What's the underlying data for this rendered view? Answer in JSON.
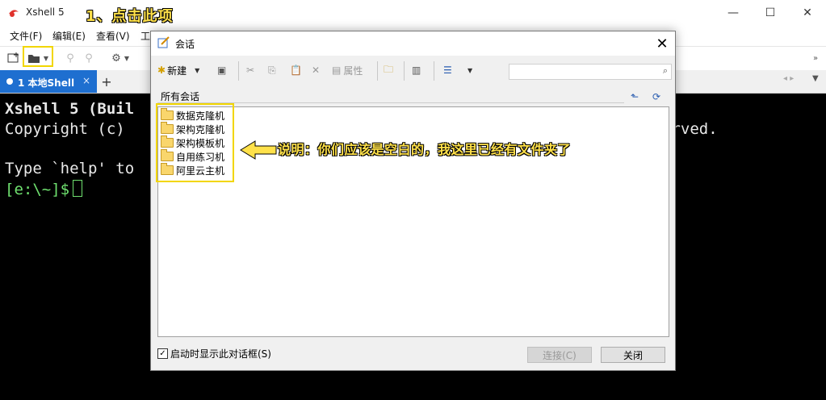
{
  "app": {
    "title": "Xshell 5",
    "brand_color": "#e0322d"
  },
  "annotation_top": "1、点击此项",
  "menu": [
    "文件(F)",
    "编辑(E)",
    "查看(V)",
    "工"
  ],
  "tabs": {
    "active_label": "1 本地Shell",
    "close": "×",
    "add": "+"
  },
  "terminal": {
    "line1": "Xshell 5 (Buil",
    "line1_right": "erved.",
    "line2": "Copyright (c)",
    "line3": "Type `help' to",
    "prompt": "[e:\\~]$"
  },
  "dialog": {
    "title": "会话",
    "close": "✕",
    "toolbar": {
      "new_label": "新建",
      "properties_label": "属性"
    },
    "search_placeholder": "",
    "path_label": "所有会话",
    "folders": [
      "数据克隆机",
      "架构克隆机",
      "架构模板机",
      "自用练习机",
      "阿里云主机"
    ],
    "note": "说明：你们应该是空白的，我这里已经有文件夹了",
    "startup_checkbox_label": "启动时显示此对话框(S)",
    "startup_checked": true,
    "connect_button": "连接(C)",
    "close_button": "关闭"
  }
}
